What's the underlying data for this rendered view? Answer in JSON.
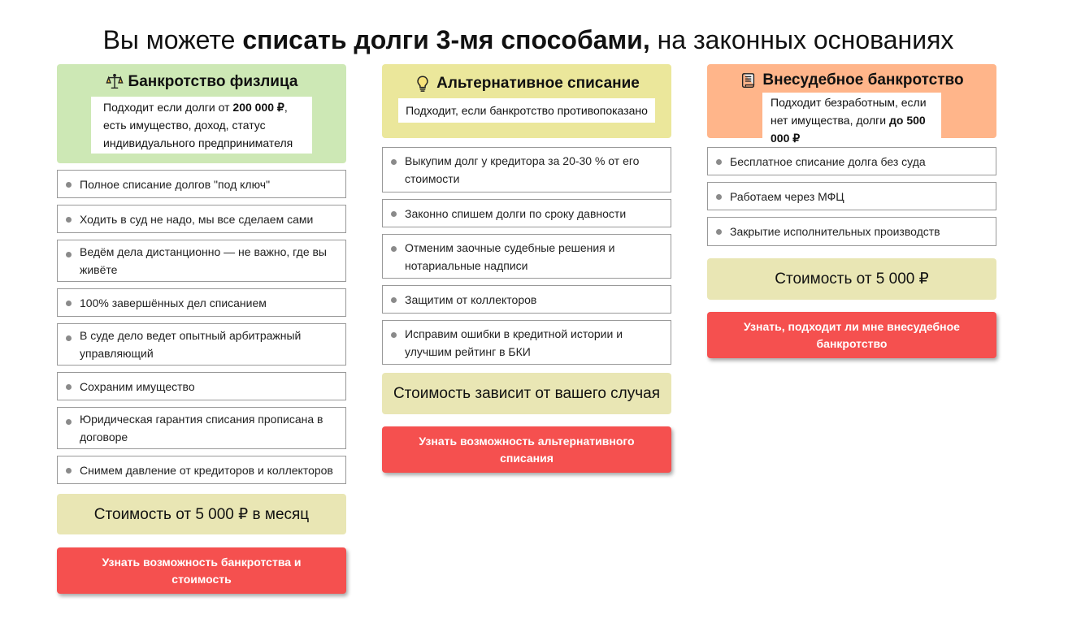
{
  "title": {
    "prefix": "Вы можете ",
    "bold": "списать долги 3-мя способами,",
    "suffix": " на законных основаниях"
  },
  "colors": {
    "col0_header": "#cde8b5",
    "col1_header": "#ebe79b",
    "col2_header": "#ffb58a",
    "price_bg": "#e9e6b4",
    "cta_bg": "#f5504f"
  },
  "columns": [
    {
      "icon": "scales-icon",
      "title": "Банкротство физлица",
      "subtitle": {
        "part1": "Подходит если долги от ",
        "bold": "200 000 ₽",
        "part2": ", есть имущество, доход, статус индивидуального предпринимателя"
      },
      "items": [
        "Полное списание долгов \"под ключ\"",
        "Ходить в суд не надо, мы все сделаем сами",
        "Ведём дела дистанционно — не важно, где вы живёте",
        "100% завершённых дел списанием",
        "В суде дело ведет опытный арбитражный управляющий",
        "Сохраним имущество",
        "Юридическая гарантия списания прописана в договоре",
        "Снимем давление от кредиторов и коллекторов"
      ],
      "price": "Стоимость от 5 000 ₽ в месяц",
      "cta": "Узнать возможность банкротства и стоимость"
    },
    {
      "icon": "lightbulb-icon",
      "title": "Альтернативное списание",
      "subtitle": {
        "part1": "Подходит, если банкротство противопоказано",
        "bold": "",
        "part2": ""
      },
      "items": [
        "Выкупим долг у кредитора за 20-30 % от его стоимости",
        "Законно спишем долги по сроку давности",
        "Отменим заочные судебные решения и нотариальные надписи",
        "Защитим от коллекторов",
        "Исправим ошибки в кредитной истории и улучшим рейтинг в БКИ"
      ],
      "price": "Стоимость зависит от вашего случая",
      "cta": "Узнать возможность альтернативного списания"
    },
    {
      "icon": "scroll-icon",
      "title": "Внесудебное банкротство",
      "subtitle": {
        "part1": "Подходит безработным, если нет имущества, долги ",
        "bold": "до 500 000 ₽",
        "part2": ""
      },
      "items": [
        "Бесплатное списание долга без суда",
        "Работаем через МФЦ",
        "Закрытие исполнительных производств"
      ],
      "price": "Стоимость от 5 000 ₽",
      "cta": "Узнать, подходит ли мне внесудебное банкротство"
    }
  ]
}
